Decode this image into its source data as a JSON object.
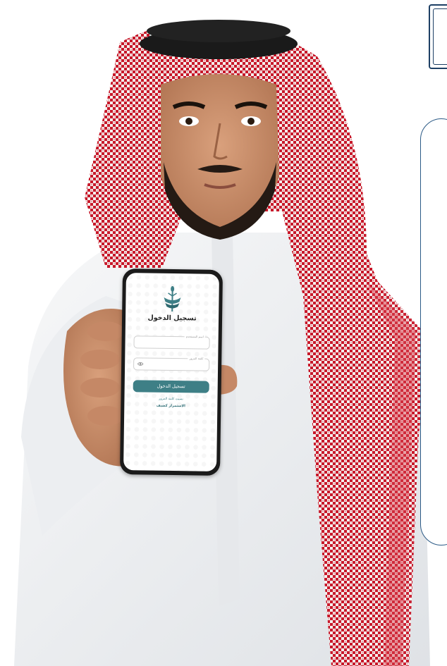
{
  "phone_app": {
    "login_title": "تسجيل الدخول",
    "username_label": "اسم المستخدم",
    "password_label": "كلمة المرور",
    "login_button": "تسجيل الدخول",
    "forgot_password": "نسيت كلمة المرور",
    "guest_login": "الاستمرار كضيف",
    "accent_color": "#3e7f86"
  },
  "icons": {
    "logo": "wheat-logo-icon",
    "password_toggle": "eye-icon"
  },
  "frame_color": "#1d3f64"
}
